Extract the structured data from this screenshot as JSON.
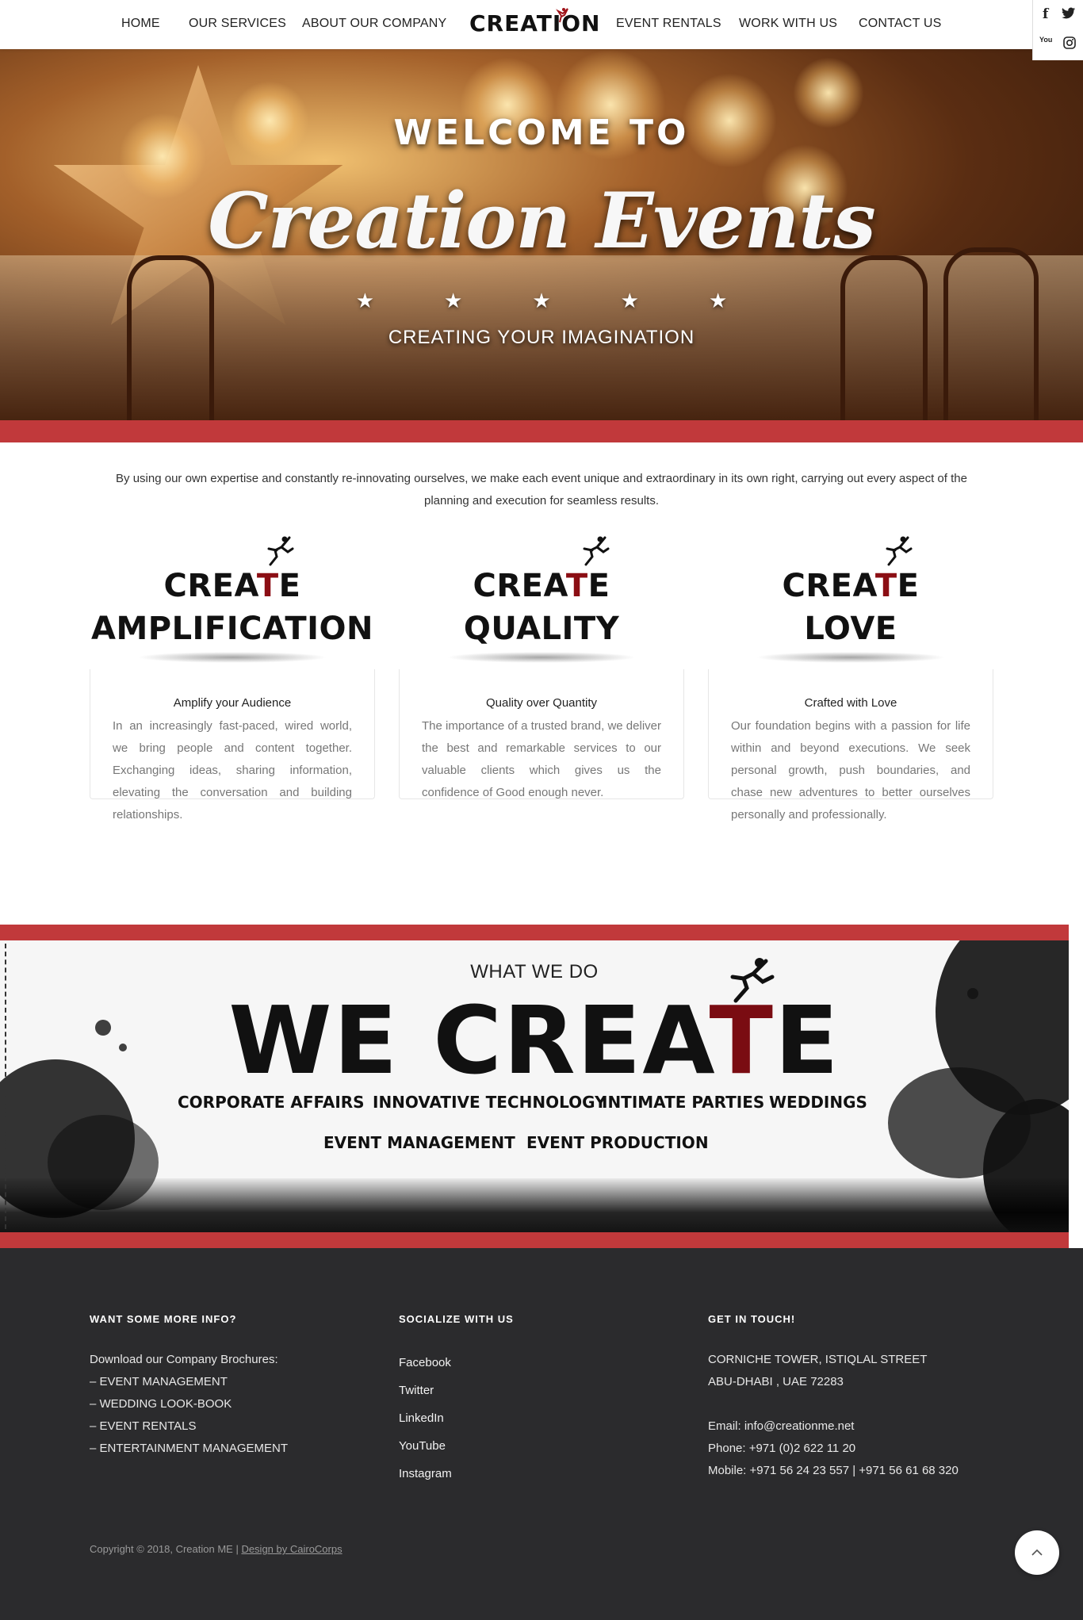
{
  "nav": {
    "items": [
      "HOME",
      "OUR SERVICES",
      "ABOUT OUR COMPANY",
      "EVENT RENTALS",
      "WORK WITH US",
      "CONTACT US"
    ],
    "logo": "CREATION",
    "social": [
      "f",
      "t",
      "You",
      "ig"
    ]
  },
  "hero": {
    "welcome": "WELCOME TO",
    "title": "Creation Events",
    "stars": "★★★★★",
    "tagline": "CREATING YOUR IMAGINATION"
  },
  "intro": "By using our own expertise and constantly re-innovating ourselves, we make each event unique and extraordinary in its own right, carrying out every aspect of the planning and execution for seamless results.",
  "features": [
    {
      "head_a": "CREA",
      "head_t": "T",
      "head_e": "E",
      "head_b": "AMPLIFICATION",
      "title": "Amplify your Audience",
      "text": "In an increasingly fast-paced, wired world, we bring people and content together. Exchanging ideas, sharing information, elevating the conversation and building relationships."
    },
    {
      "head_a": "CREA",
      "head_t": "T",
      "head_e": "E",
      "head_b": "QUALITY",
      "title": "Quality over Quantity",
      "text": "The importance of a trusted brand, we deliver the best and remarkable services to our valuable clients which gives us the confidence of Good enough never."
    },
    {
      "head_a": "CREA",
      "head_t": "T",
      "head_e": "E",
      "head_b": "LOVE",
      "title": "Crafted with Love",
      "text": "Our foundation begins with a passion for life within and beyond executions. We seek personal growth, push boundaries, and chase new adventures to better ourselves personally and professionally."
    }
  ],
  "what_we_do": {
    "label": "WHAT WE DO",
    "big_a": "WE CREA",
    "big_t": "T",
    "big_e": "E",
    "services": [
      "CORPORATE AFFAIRS",
      "INNOVATIVE TECHNOLOGY",
      "INTIMATE PARTIES",
      "WEDDINGS",
      "EVENT MANAGEMENT",
      "EVENT PRODUCTION"
    ]
  },
  "footer": {
    "col1_head": "WANT SOME MORE INFO?",
    "col1_intro": "Download our Company Brochures:",
    "col1_links": [
      "– EVENT MANAGEMENT",
      "– WEDDING LOOK-BOOK",
      "– EVENT RENTALS",
      "– ENTERTAINMENT MANAGEMENT"
    ],
    "col2_head": "SOCIALIZE WITH US",
    "col2_links": [
      "Facebook",
      "Twitter",
      "LinkedIn",
      "YouTube",
      "Instagram"
    ],
    "col3_head": "GET IN TOUCH!",
    "address1": "CORNICHE TOWER, ISTIQLAL STREET",
    "address2": "ABU-DHABI , UAE 72283",
    "email": "Email: info@creationme.net",
    "phone": "Phone: +971 (0)2 622 11 20",
    "mobile": "Mobile: +971 56 24 23 557 | +971 56 61 68 320",
    "copyright": "Copyright © 2018, Creation ME | ",
    "credit": "Design by CairoCorps",
    "to_top": "^"
  },
  "colors": {
    "accent_red": "#c1393b",
    "footer_bg": "#2b2b2d",
    "dark_red": "#8b0e14"
  }
}
